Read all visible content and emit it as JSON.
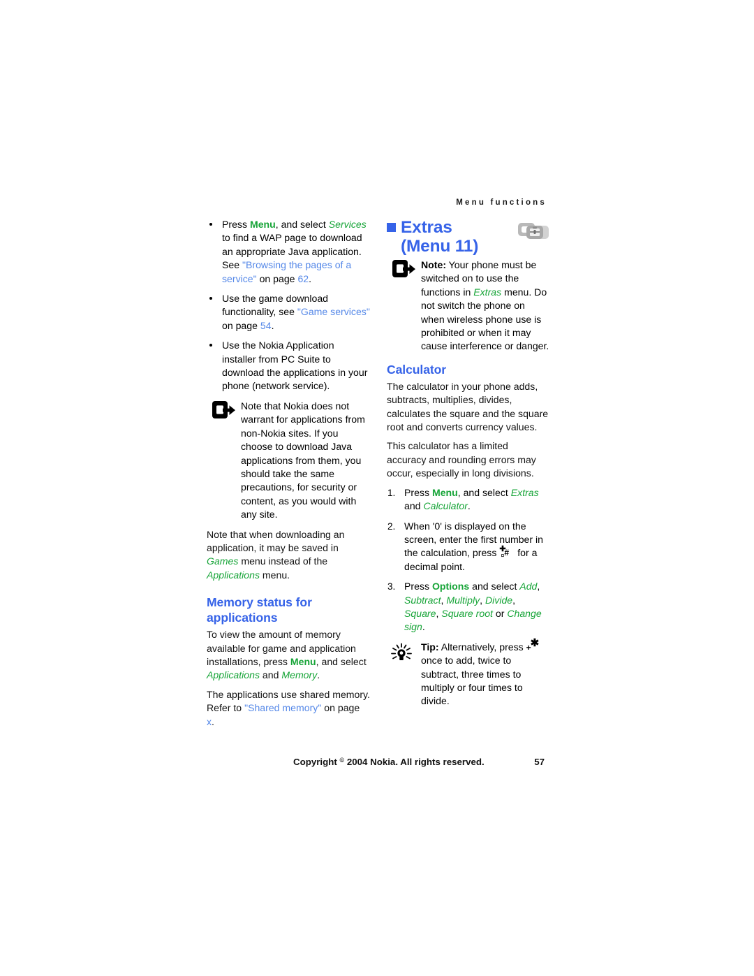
{
  "page": {
    "running_header": "Menu functions",
    "footer_copyright": "Copyright",
    "footer_copyright_rest": "2004 Nokia. All rights reserved.",
    "footer_symbol": "©",
    "page_number": "57"
  },
  "colors": {
    "heading_blue": "#3663e8",
    "ui_green": "#16a437",
    "crossref_blue": "#5588e8",
    "body_black": "#111111"
  },
  "left_column": {
    "bullets": [
      {
        "p1": "Press ",
        "ui1": "Menu",
        "p2": ", and select ",
        "ui2": "Services",
        "p3": " to find a WAP page to download an appropriate Java application. See ",
        "xref": "\"Browsing the pages of a service\"",
        "p4": " on page ",
        "xref_page": "62",
        "p5": "."
      },
      {
        "p1": "Use the game download functionality, see ",
        "xref": "\"Game services\"",
        "p2": " on page ",
        "xref_page": "54",
        "p3": "."
      },
      {
        "p1": "Use the Nokia Application installer from PC Suite to download the applications in your phone (network service)."
      }
    ],
    "note_callout": {
      "icon": "note-arrow-icon",
      "text": "Note that Nokia does not warrant for applications from non-Nokia sites. If you choose to download Java applications from them, you should take the same precautions, for security or content, as you would with any site."
    },
    "paragraph_games": {
      "p1": "Note that when downloading an application, it may be saved in ",
      "ui1": "Games",
      "p2": " menu instead of the ",
      "ui2": "Applications",
      "p3": " menu."
    },
    "memory_heading_line1": "Memory status for",
    "memory_heading_line2": "applications",
    "memory_paragraph": {
      "p1": "To view the amount of memory available for game and application installations, press ",
      "ui1": "Menu",
      "p2": ", and select ",
      "ui2": "Applications",
      "p3": " and ",
      "ui3": "Memory",
      "p4": "."
    },
    "shared_memory_paragraph": {
      "p1": "The applications use shared memory. Refer to ",
      "xref": "\"Shared memory\"",
      "p2": " on page ",
      "xref_page": "x",
      "p3": "."
    }
  },
  "right_column": {
    "chapter_title": "Extras",
    "chapter_subtitle": "(Menu 11)",
    "chapter_icon": "extras-toolbox-icon",
    "note_callout": {
      "icon": "note-arrow-icon",
      "label": "Note:",
      "p1": " Your phone must be switched on to use the functions in ",
      "ui1": "Extras",
      "p2": " menu. Do not switch the phone on when wireless phone use is prohibited or when it may cause interference or danger."
    },
    "calculator_heading": "Calculator",
    "calculator_p1": "The calculator in your phone adds, subtracts, multiplies, divides, calculates the square and the square root and converts currency values.",
    "calculator_p2": "This calculator has a limited accuracy and rounding errors may occur, especially in long divisions.",
    "steps": [
      {
        "num": "1.",
        "p1": "Press ",
        "ui1": "Menu",
        "p2": ", and select ",
        "ui2": "Extras",
        "p3": " and ",
        "ui3": "Calculator",
        "p4": "."
      },
      {
        "num": "2.",
        "p1": "When '0' is displayed on the screen, enter the first number in the calculation, press ",
        "key": "hash-key-icon",
        "key_main": "#",
        "key_up": "✚",
        "key_dn": "¤",
        "p2": " for a decimal point."
      },
      {
        "num": "3.",
        "p1": "Press ",
        "ui1": "Options",
        "p2": " and select ",
        "ui2": "Add",
        "sep1": ", ",
        "ui3": "Subtract",
        "sep2": ", ",
        "ui4": "Multiply",
        "sep3": ", ",
        "ui5": "Divide",
        "sep4": ", ",
        "ui6": "Square",
        "sep5": ", ",
        "ui7": "Square root",
        "sep6": " or ",
        "ui8": "Change sign",
        "p3": "."
      }
    ],
    "tip_callout": {
      "icon": "tip-lightbulb-icon",
      "label": "Tip:",
      "p1": " Alternatively, press ",
      "key": "star-key-icon",
      "key_up": "✱",
      "key_dn": "+",
      "p2": " once to add, twice to subtract, three times to multiply or four times to divide."
    }
  }
}
